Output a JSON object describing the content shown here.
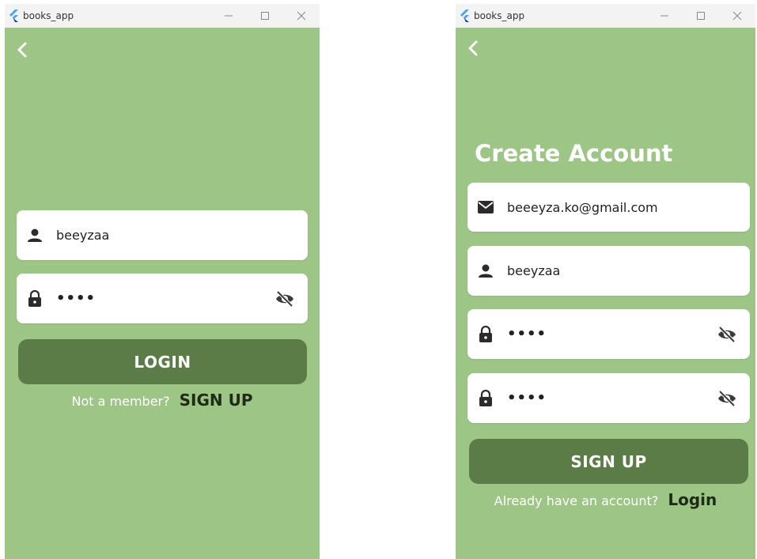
{
  "colors": {
    "background": "#9dc586",
    "button": "#5b7c47",
    "link": "#1e2b17",
    "titlebar": "#f3f3f3"
  },
  "login_window": {
    "title": "books_app",
    "controls": [
      "minimize-icon",
      "maximize-icon",
      "close-icon"
    ],
    "back_icon": "chevron-left-icon",
    "username_field": {
      "icon": "person-icon",
      "value": "beeyzaa"
    },
    "password_field": {
      "icon": "lock-icon",
      "value": "••••",
      "toggle_icon": "eye-off-icon"
    },
    "login_button": "LOGIN",
    "prompt": "Not a member?",
    "signup_link": "SIGN UP"
  },
  "signup_window": {
    "title": "books_app",
    "controls": [
      "minimize-icon",
      "maximize-icon",
      "close-icon"
    ],
    "back_icon": "chevron-left-icon",
    "heading": "Create Account",
    "email_field": {
      "icon": "mail-icon",
      "value": "beeeyza.ko@gmail.com"
    },
    "username_field": {
      "icon": "person-icon",
      "value": "beeyzaa"
    },
    "password_field": {
      "icon": "lock-icon",
      "value": "••••",
      "toggle_icon": "eye-off-icon"
    },
    "confirm_password_field": {
      "icon": "lock-icon",
      "value": "••••",
      "toggle_icon": "eye-off-icon"
    },
    "signup_button": "SIGN UP",
    "prompt": "Already have an account?",
    "login_link": "Login"
  }
}
